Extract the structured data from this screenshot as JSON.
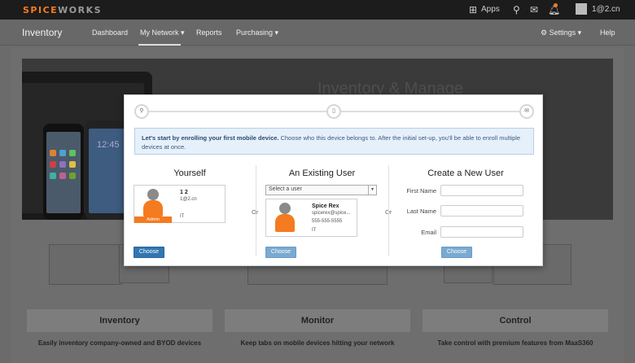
{
  "topbar": {
    "brand_a": "SPICE",
    "brand_b": "WORKS",
    "apps_label": "Apps",
    "user_label": "1@2.cn",
    "icons": [
      "apps-grid-icon",
      "search-icon",
      "mail-icon",
      "bell-icon"
    ]
  },
  "nav": {
    "title": "Inventory",
    "items": [
      "Dashboard",
      "My Network ▾",
      "Reports",
      "Purchasing ▾"
    ],
    "settings": "⚙ Settings ▾",
    "help": "Help"
  },
  "hero": {
    "title": "Inventory & Manage",
    "phone_time": "12:45"
  },
  "features": [
    {
      "title": "Inventory",
      "desc": "Easily inventory company-owned and BYOD devices"
    },
    {
      "title": "Monitor",
      "desc": "Keep tabs on mobile devices hitting your network"
    },
    {
      "title": "Control",
      "desc": "Take control with premium features from MaaS360"
    }
  ],
  "modal": {
    "info_bold": "Let's start by enrolling your first mobile device.",
    "info_text": " Choose who this device belongs to. After the initial set-up, you'll be able to enroll multiple devices at once.",
    "or_label": "Or",
    "yourself": {
      "title": "Yourself",
      "name": "1 2",
      "email": "1@2.cn",
      "dept": "IT",
      "badge": "Admin",
      "button": "Choose"
    },
    "existing": {
      "title": "An Existing User",
      "select_placeholder": "Select a user",
      "name": "Spice Rex",
      "email": "spicerex@spice...",
      "phone": "555-555-5555",
      "dept": "IT",
      "button": "Choose"
    },
    "new_user": {
      "title": "Create a New User",
      "first_name": "First Name",
      "last_name": "Last Name",
      "email": "Email",
      "button": "Choose"
    }
  }
}
